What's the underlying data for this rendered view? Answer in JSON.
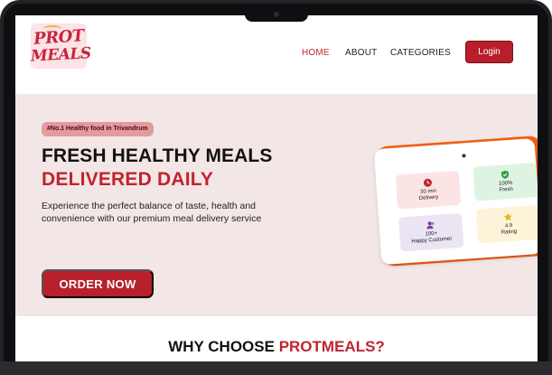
{
  "brand": {
    "logo_line1": "PROT",
    "logo_line2": "MEALS",
    "accent_color": "#c0242f"
  },
  "nav": {
    "home": "HOME",
    "about": "ABOUT",
    "categories": "CATEGORIES",
    "login": "Login"
  },
  "hero": {
    "badge": "#No.1 Healthy food in Trivandrum",
    "title_line1": "FRESH HEALTHY MEALS",
    "title_line2": "DELIVERED DAILY",
    "description": "Experience the perfect balance of taste, health and convenience with our premium meal delivery service",
    "cta": "ORDER NOW"
  },
  "stats": [
    {
      "line1": "30 min",
      "line2": "Delivery",
      "icon": "clock-icon",
      "color": "#c0242f"
    },
    {
      "line1": "100%",
      "line2": "Fresh",
      "icon": "shield-check-icon",
      "color": "#2fa24a"
    },
    {
      "line1": "100+",
      "line2": "Happy Customer",
      "icon": "users-icon",
      "color": "#7a3fa0"
    },
    {
      "line1": "4.9",
      "line2": "Rating",
      "icon": "star-icon",
      "color": "#e7b21f"
    }
  ],
  "section": {
    "why_prefix": "WHY CHOOSE ",
    "why_brand": "PROTMEALS?"
  }
}
